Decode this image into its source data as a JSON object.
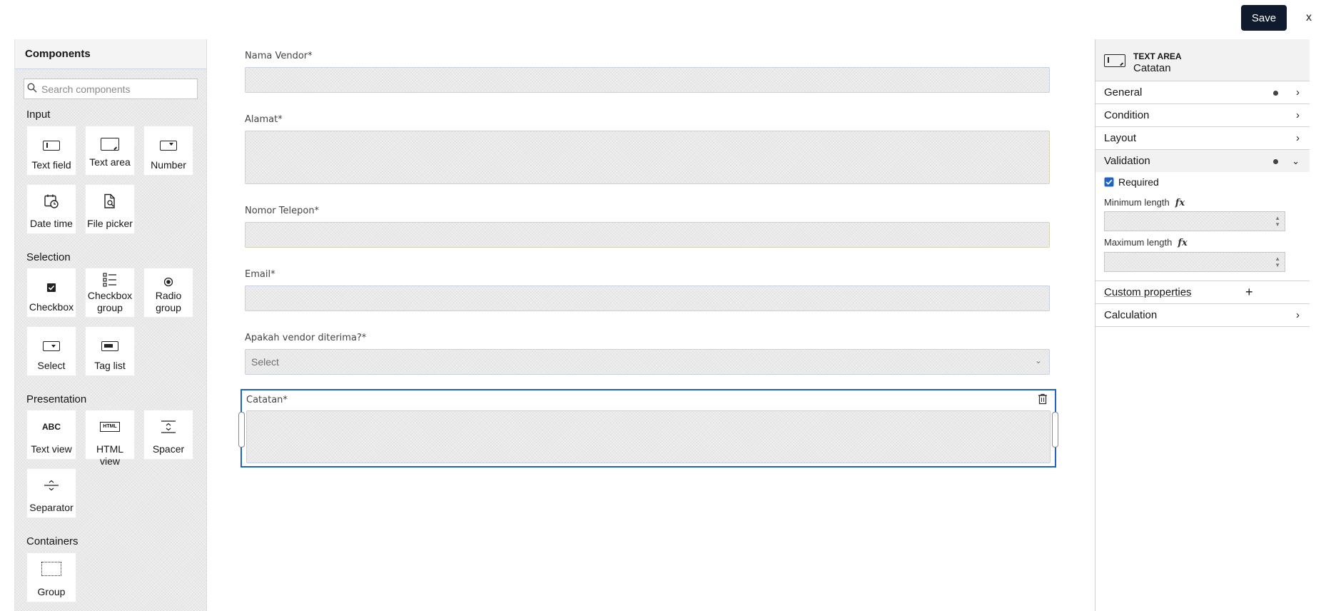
{
  "topbar": {
    "save_label": "Save",
    "close_label": "x"
  },
  "components": {
    "title": "Components",
    "search_placeholder": "Search components",
    "categories": [
      {
        "label": "Input",
        "items": [
          "Text field",
          "Text area",
          "Number",
          "Date time",
          "File picker"
        ]
      },
      {
        "label": "Selection",
        "items": [
          "Checkbox",
          "Checkbox group",
          "Radio group",
          "Select",
          "Tag list"
        ]
      },
      {
        "label": "Presentation",
        "items": [
          "Text view",
          "HTML view",
          "Spacer",
          "Separator"
        ]
      },
      {
        "label": "Containers",
        "items": [
          "Group"
        ]
      }
    ],
    "text_view_icon_text": "ABC",
    "html_view_icon_text": "HTML"
  },
  "form": {
    "fields": [
      {
        "label": "Nama Vendor*"
      },
      {
        "label": "Alamat*"
      },
      {
        "label": "Nomor Telepon*"
      },
      {
        "label": "Email*"
      },
      {
        "label": "Apakah vendor diterima?*",
        "placeholder": "Select"
      },
      {
        "label": "Catatan*"
      }
    ]
  },
  "properties": {
    "component_type": "TEXT AREA",
    "component_name": "Catatan",
    "sections": {
      "general": "General",
      "condition": "Condition",
      "layout": "Layout",
      "validation": "Validation",
      "custom": "Custom properties",
      "calculation": "Calculation"
    },
    "validation": {
      "required_label": "Required",
      "required_checked": true,
      "min_label": "Minimum length",
      "max_label": "Maximum length",
      "fx_label": "fx"
    }
  },
  "colors": {
    "accent": "#1f63c9",
    "save_bg": "#0f1b2d"
  }
}
